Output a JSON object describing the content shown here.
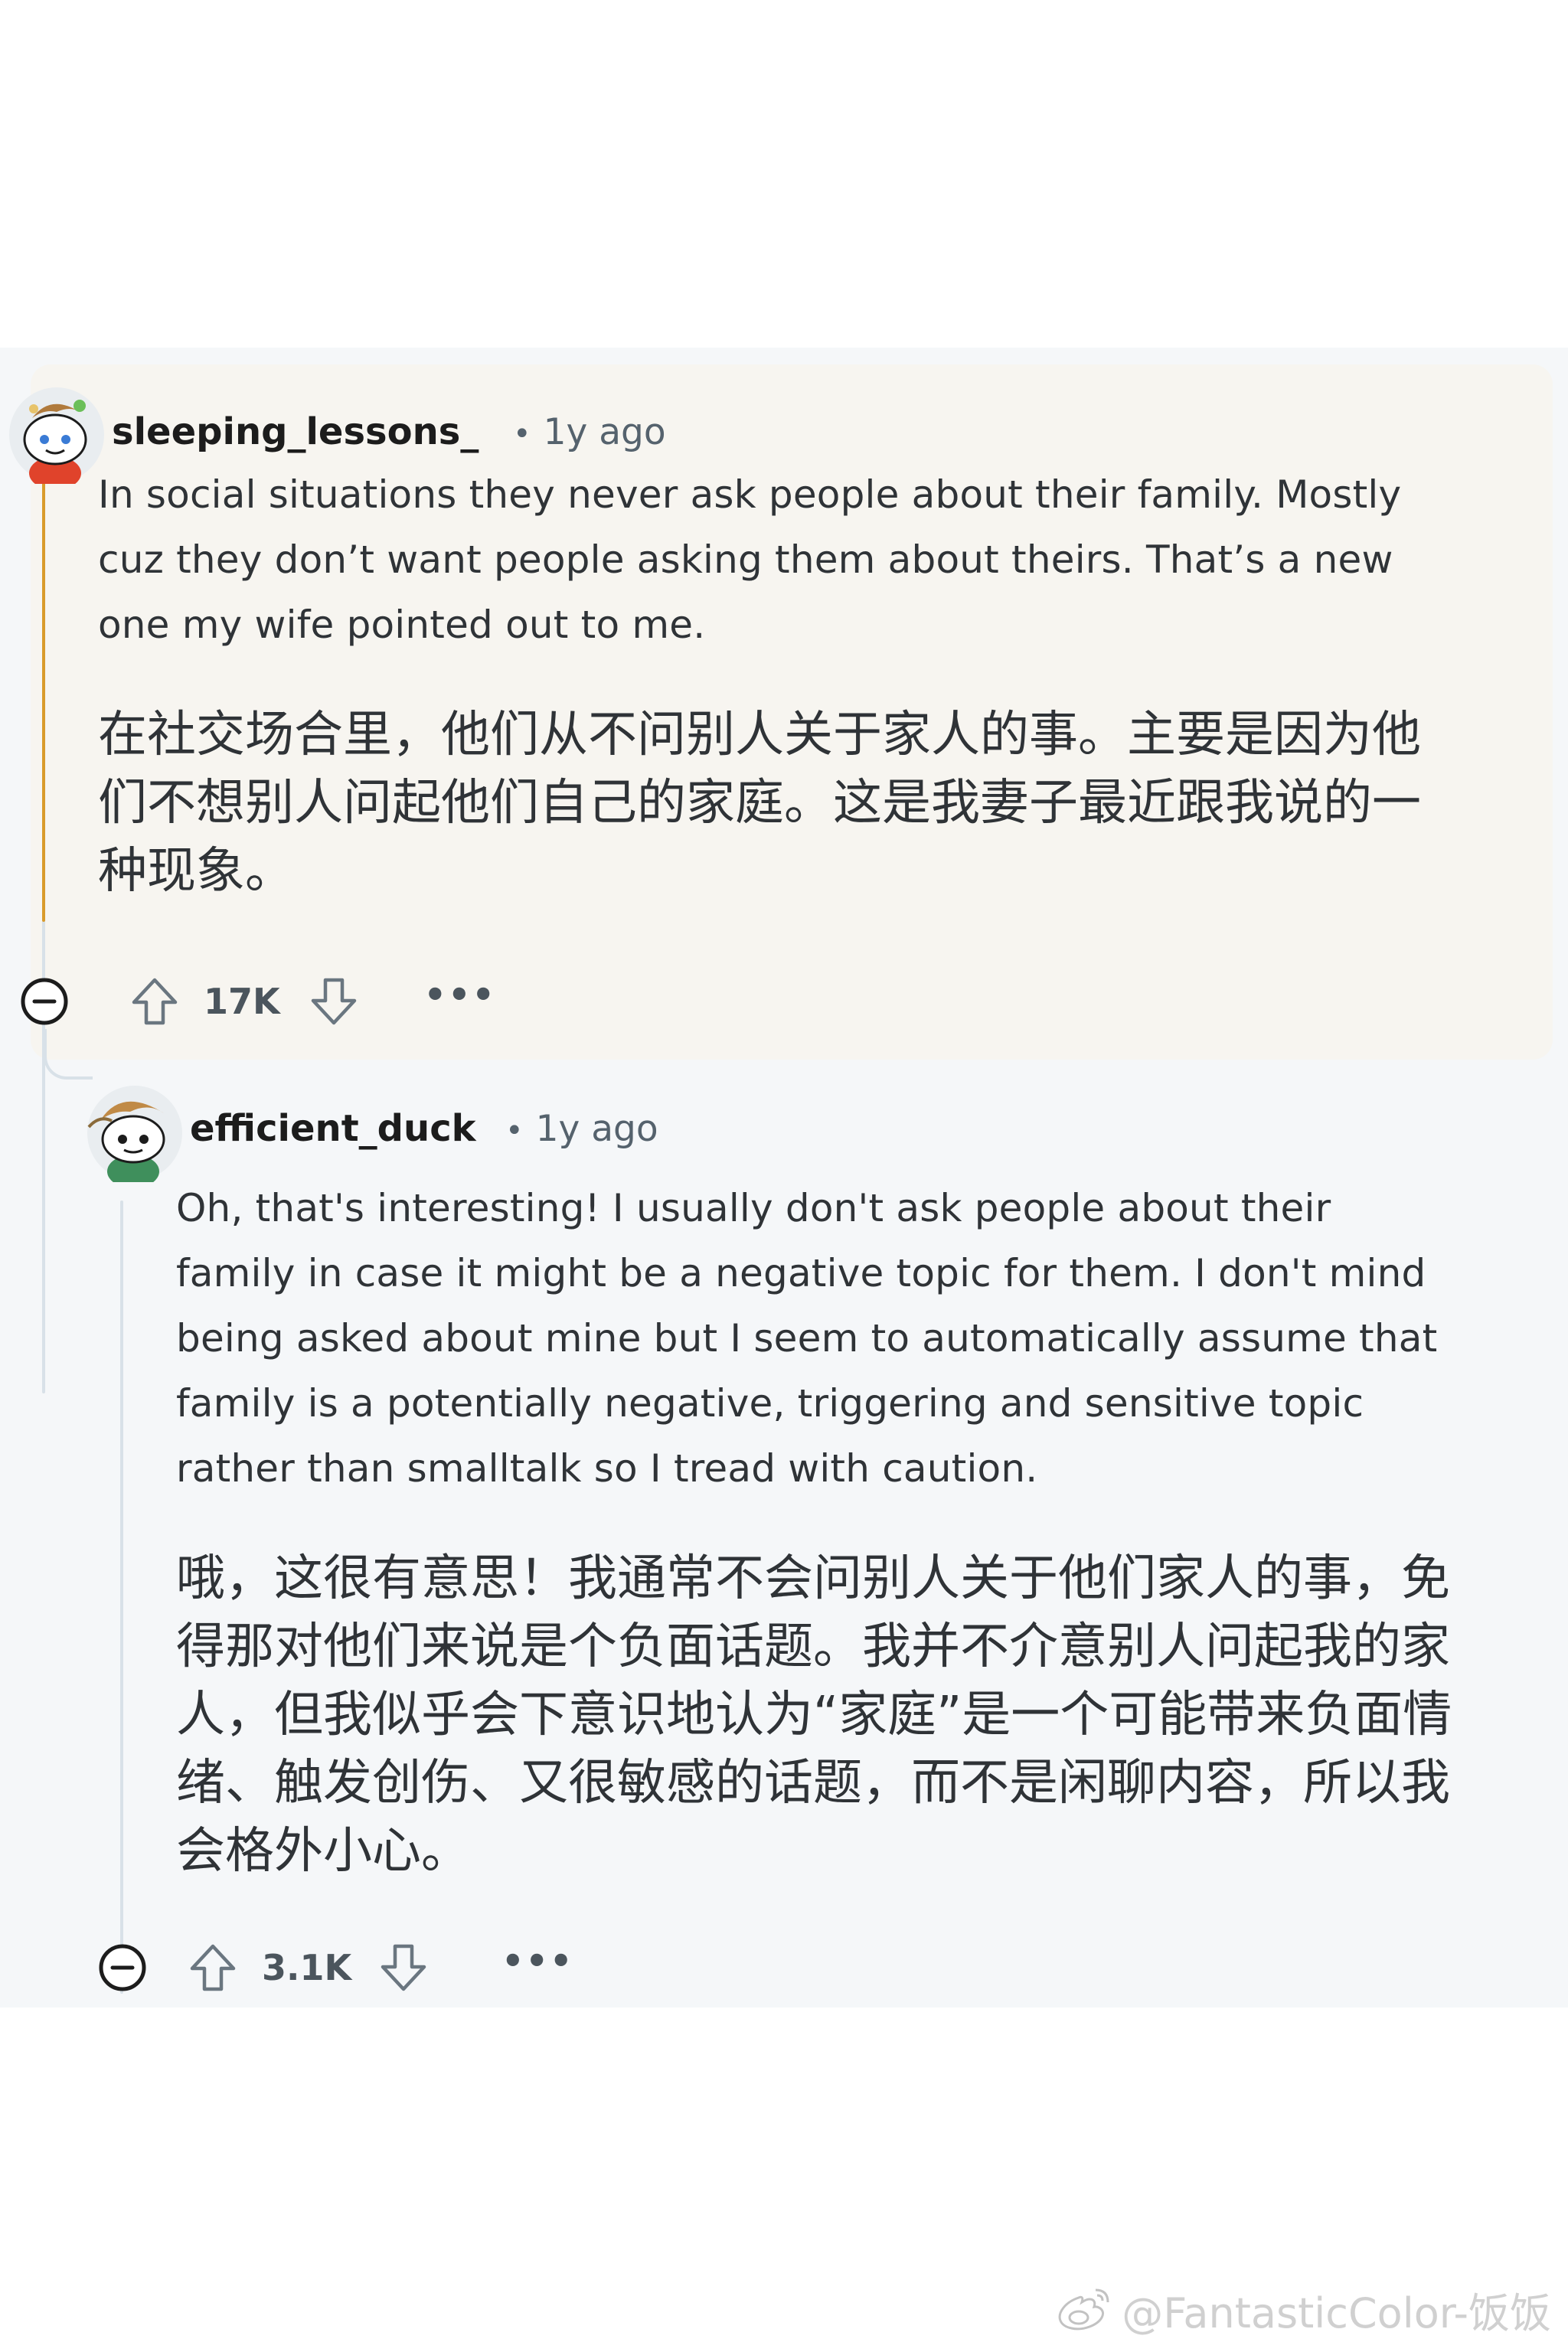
{
  "comments": [
    {
      "username": "sleeping_lessons_",
      "time": "1y ago",
      "avatar": "snoo-avatar-red-shirt",
      "body_en_lines": [
        "In social situations they never ask people about their family. Mostly",
        "cuz they don’t want people asking them about theirs. That’s a new",
        "one my wife pointed out to me."
      ],
      "body_zh_lines": [
        "在社交场合里，他们从不问别人关于家人的事。主要是因为他",
        "们不想别人问起他们自己的家庭。这是我妻子最近跟我说的一",
        "种现象。"
      ],
      "votes": "17K",
      "highlighted": true,
      "accent_color": "#d99b2b"
    },
    {
      "username": "efficient_duck",
      "time": "1y ago",
      "avatar": "snoo-avatar-green-shirt",
      "body_en_lines": [
        "Oh, that's interesting! I usually don't ask people about their",
        "family in case it might be a negative topic for them. I don't mind",
        "being asked about mine but I seem to automatically assume that",
        "family is a potentially negative, triggering and sensitive topic",
        "rather than smalltalk so I tread with caution."
      ],
      "body_zh_lines": [
        "哦，这很有意思！我通常不会问别人关于他们家人的事，免",
        "得那对他们来说是个负面话题。我并不介意别人问起我的家",
        "人，但我似乎会下意识地认为“家庭”是一个可能带来负面情",
        "绪、触发创伤、又很敏感的话题，而不是闲聊内容，所以我",
        "会格外小心。"
      ],
      "votes": "3.1K",
      "highlighted": false
    }
  ],
  "icons": {
    "collapse": "collapse-minus-icon",
    "upvote": "upvote-arrow-icon",
    "downvote": "downvote-arrow-icon",
    "more": "more-options-icon"
  },
  "watermark": {
    "icon": "weibo-logo-icon",
    "text": "@FantasticColor-饭饭"
  },
  "colors": {
    "page_bg": "#ffffff",
    "panel_bg": "#f5f7f9",
    "highlight_bg": "#f7f5f0",
    "thread_line": "#d8e1e8"
  }
}
